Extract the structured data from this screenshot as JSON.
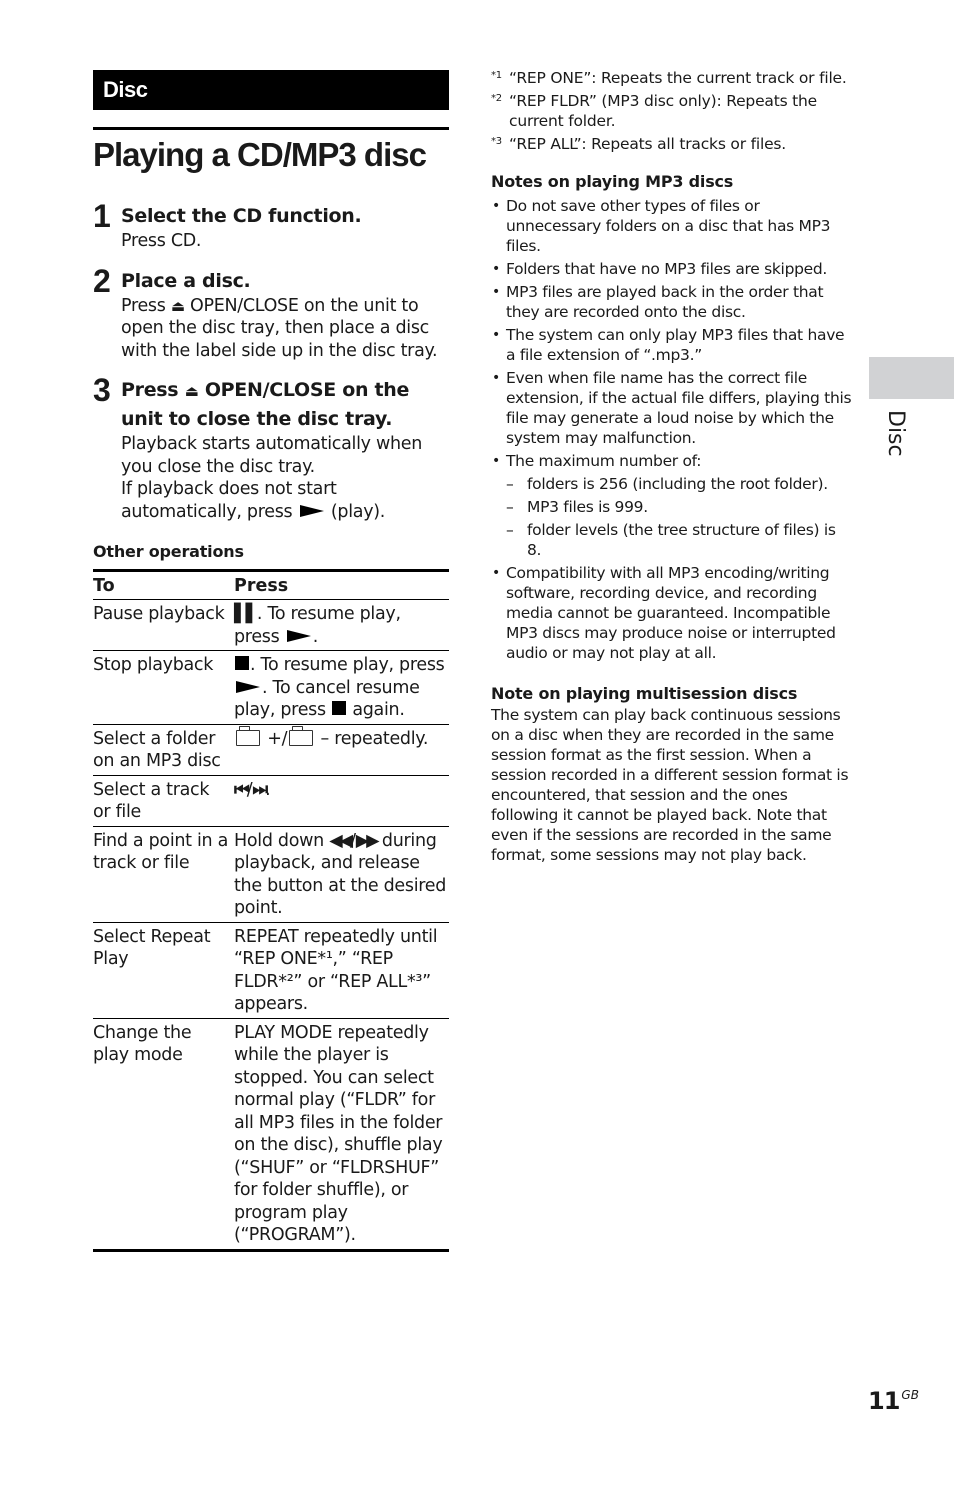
{
  "section": "Disc",
  "title": "Playing a CD/MP3 disc",
  "steps": [
    {
      "num": "1",
      "heading": "Select the CD function.",
      "body": "Press CD."
    },
    {
      "num": "2",
      "heading": "Place a disc.",
      "body_pre": "Press ",
      "body_post": " OPEN/CLOSE on the unit to open the disc tray, then place a disc with the label side up in the disc tray."
    },
    {
      "num": "3",
      "heading_pre": "Press ",
      "heading_post": " OPEN/CLOSE on the unit to close the disc tray.",
      "body_1": "Playback starts automatically when you close the disc tray.",
      "body_2_pre": "If playback does not start automatically, press ",
      "body_2_post": " (play)."
    }
  ],
  "icons": {
    "eject": "⏏",
    "pause": "▌▌",
    "prev": "⏮",
    "next": "⏭",
    "rew": "◀◀",
    "ff": "▶▶"
  },
  "other_operations": {
    "title": "Other operations",
    "headers": [
      "To",
      "Press"
    ],
    "rows": [
      {
        "to": "Pause playback",
        "press_a": ". To resume play, press ",
        "press_b": "."
      },
      {
        "to": "Stop playback",
        "press_a": ". To resume play, press ",
        "press_b": ". To cancel resume play, press ",
        "press_c": " again."
      },
      {
        "to": "Select a folder on an MP3 disc",
        "press_a": " +/",
        "press_b": " – repeatedly."
      },
      {
        "to": "Select a track or file",
        "press_a": "/",
        "press_b": "."
      },
      {
        "to": "Find a point in a track or file",
        "press_a": "Hold down ",
        "press_b": "/",
        "press_c": " during playback, and release the button at the desired point."
      },
      {
        "to": "Select Repeat Play",
        "press": "REPEAT repeatedly until “REP ONE*¹,” “REP FLDR*²” or “REP ALL*³” appears."
      },
      {
        "to": "Change the play mode",
        "press": "PLAY MODE repeatedly while the player is stopped. You can select normal play (“FLDR” for all MP3 files in the folder on the disc), shuffle play (“SHUF” or “FLDRSHUF” for folder shuffle), or program play (“PROGRAM”)."
      }
    ]
  },
  "footnotes": [
    {
      "mark": "*1",
      "text": "“REP ONE”: Repeats the current track or file."
    },
    {
      "mark": "*2",
      "text": "“REP FLDR” (MP3 disc only): Repeats the current folder."
    },
    {
      "mark": "*3",
      "text": "“REP ALL”: Repeats all tracks or files."
    }
  ],
  "notes_mp3": {
    "title": "Notes on playing MP3 discs",
    "bullets": [
      "Do not save other types of files or unnecessary folders on a disc that has MP3 files.",
      "Folders that have no MP3 files are skipped.",
      "MP3 files are played back in the order that they are recorded onto the disc.",
      "The system can only play MP3 files that have a file extension of “.mp3.”",
      "Even when file name has the correct file extension, if the actual file differs, playing this file may generate a loud noise by which the system may malfunction.",
      "The maximum number of:"
    ],
    "sub_items": [
      "folders is 256 (including the root folder).",
      "MP3 files is 999.",
      "folder levels (the tree structure of files) is 8."
    ],
    "last_bullet": "Compatibility with all MP3 encoding/writing software, recording device, and recording media cannot be guaranteed. Incompatible MP3 discs may produce noise or interrupted audio or may not play at all."
  },
  "note_multisession": {
    "title": "Note on playing multisession discs",
    "body": "The system can play back continuous sessions on a disc when they are recorded in the same session format as the first session. When a session recorded in a different session format is encountered, that session and the ones following it cannot be played back. Note that even if the sessions are recorded in the same format, some sessions may not play back."
  },
  "side_tab": "Disc",
  "page_number": "11",
  "page_suffix": "GB",
  "colors": {
    "tab_gray": "#d1d2d4",
    "bar_black": "#000000"
  }
}
